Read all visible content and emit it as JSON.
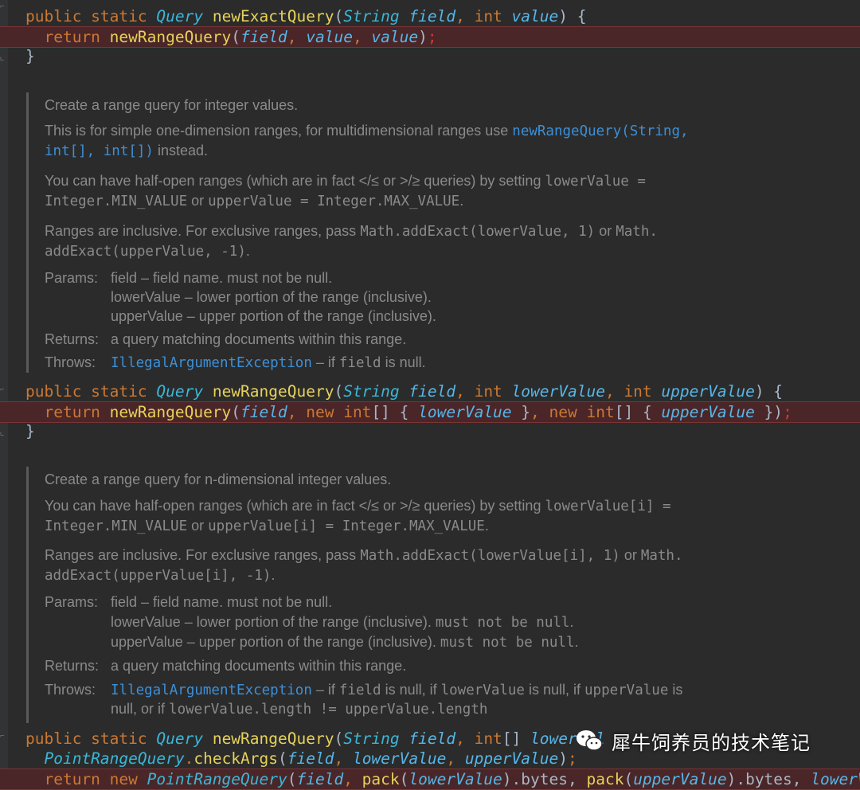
{
  "code": {
    "l1": {
      "a": "public static ",
      "b": "Query ",
      "c": "newExactQuery",
      "d": "(",
      "e": "String ",
      "f": "field",
      ", ": ", ",
      "g": "int ",
      "h": "value",
      ") {": ") {"
    },
    "l2": {
      "a": "  return ",
      "b": "newRangeQuery",
      "c": "(",
      "d": "field",
      ", ": ", ",
      "e": "value",
      ", 2": ", ",
      "f": "value",
      "g": ")",
      ";": ";"
    },
    "l3": "}",
    "l4": {
      "a": "public static ",
      "b": "Query ",
      "c": "newRangeQuery",
      "d": "(",
      "e": "String ",
      "f": "field",
      ", ": ", ",
      "g": "int ",
      "h": "lowerValue",
      ", 2": ", ",
      "i": "int ",
      "j": "upperValue",
      "k": ") {"
    },
    "l5": {
      "a": "  return ",
      "b": "newRangeQuery",
      "c": "(",
      "d": "field",
      ", ": ", ",
      "e": "new ",
      "f": "int",
      "g": "[] { ",
      "h": "lowerValue",
      "i": " }",
      ", 2": ", ",
      "j": "new ",
      "k": "int",
      "l": "[] { ",
      "m": "upperValue",
      "n": " })",
      ";": ";"
    },
    "l6": "}",
    "l7": {
      "a": "public static ",
      "b": "Query ",
      "c": "newRangeQuery",
      "d": "(",
      "e": "String ",
      "f": "field",
      ", ": ", ",
      "g": "int",
      "h": "[] ",
      "i": "lowerVal"
    },
    "l8": {
      "a": "  ",
      "b": "PointRangeQuery",
      ".": ".",
      "c": "checkArgs",
      "d": "(",
      "e": "field",
      ", ": ", ",
      "f": "lowerValue",
      ", 2": ", ",
      "g": "upperValue",
      "h": ")",
      ";": ";"
    },
    "l9": {
      "a": "  return new ",
      "b": "PointRangeQuery",
      "c": "(",
      "d": "field",
      ", ": ", ",
      "e": "pack",
      "f": "(",
      "g": "lowerValue",
      "h": ").bytes, ",
      "i": "pack",
      "j": "(",
      "k": "upperValue",
      "l": ").bytes, ",
      "m": "lowerVa"
    }
  },
  "doc1": {
    "summary": "Create a range query for integer values.",
    "p1a": "This is for simple one-dimension ranges, for multidimensional ranges use ",
    "p1link1": "newRangeQuery(String,",
    "p1link2": "int[], int[])",
    "p1b": " instead.",
    "p2a": "You can have half-open ranges (which are in fact </≤ or >/≥ queries) by setting ",
    "p2m1": "lowerValue =",
    "p2m2": "Integer.MIN_VALUE",
    "p2b": " or ",
    "p2m3": "upperValue = Integer.MAX_VALUE",
    "p2c": ".",
    "p3a": "Ranges are inclusive. For exclusive ranges, pass ",
    "p3m1": "Math.addExact(lowerValue, 1)",
    "p3b": " or ",
    "p3m2": "Math.",
    "p3m3": "addExact(upperValue, -1)",
    "p3c": ".",
    "params_label": "Params:",
    "param1": "field – field name. must not be null.",
    "param2": "lowerValue – lower portion of the range (inclusive).",
    "param3": "upperValue – upper portion of the range (inclusive).",
    "returns_label": "Returns:",
    "returns": "a query matching documents within this range.",
    "throws_label": "Throws:",
    "throws_link": "IllegalArgumentException",
    "throws_a": " – if ",
    "throws_m": "field",
    "throws_b": " is null."
  },
  "doc2": {
    "summary": "Create a range query for n-dimensional integer values.",
    "p2a": "You can have half-open ranges (which are in fact </≤ or >/≥ queries) by setting ",
    "p2m1": "lowerValue[i] =",
    "p2m2": "Integer.MIN_VALUE",
    "p2b": " or ",
    "p2m3": "upperValue[i] = Integer.MAX_VALUE",
    "p2c": ".",
    "p3a": "Ranges are inclusive. For exclusive ranges, pass ",
    "p3m1": "Math.addExact(lowerValue[i], 1)",
    "p3b": " or ",
    "p3m2": "Math.",
    "p3m3": "addExact(upperValue[i], -1)",
    "p3c": ".",
    "params_label": "Params:",
    "param1": "field – field name. must not be null.",
    "param2a": "lowerValue – lower portion of the range (inclusive). ",
    "param2m": "must not be null",
    "param2b": ".",
    "param3a": "upperValue – upper portion of the range (inclusive). ",
    "param3m": "must not be null",
    "param3b": ".",
    "returns_label": "Returns:",
    "returns": "a query matching documents within this range.",
    "throws_label": "Throws:",
    "throws_link": "IllegalArgumentException",
    "throws_a": " – if ",
    "throws_m1": "field",
    "throws_b": " is null, if ",
    "throws_m2": "lowerValue",
    "throws_c": " is null, if ",
    "throws_m3": "upperValue",
    "throws_d": " is",
    "throws_e": "null, or if ",
    "throws_m4": "lowerValue.length != upperValue.length"
  },
  "watermark": {
    "text": "犀牛饲养员的技术笔记",
    "icon": "wechat-icon"
  }
}
